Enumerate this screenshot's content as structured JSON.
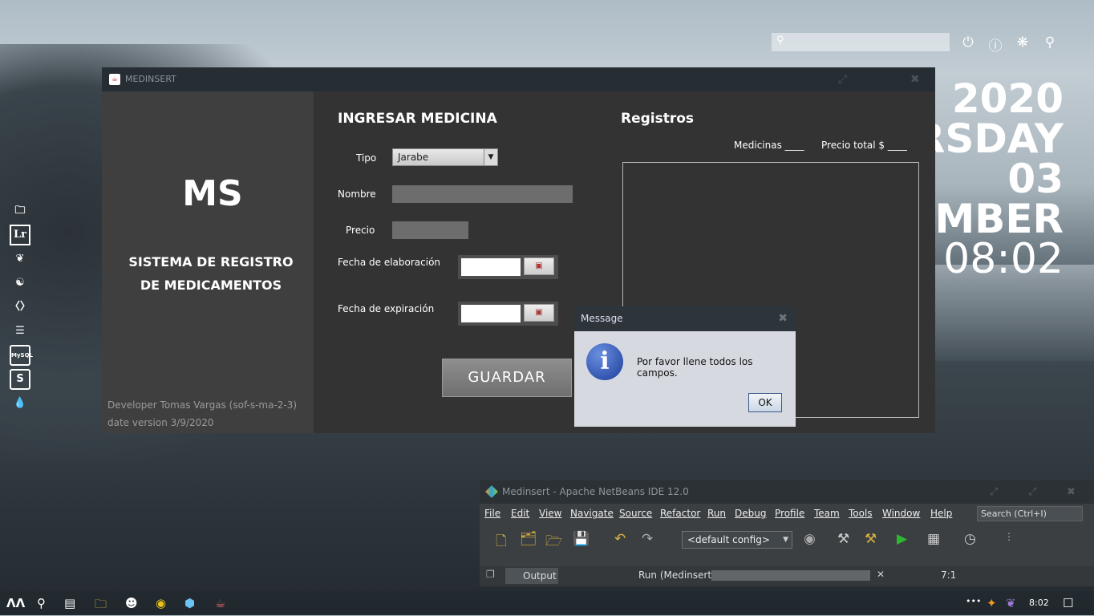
{
  "desktop": {
    "clock": {
      "year": "2020",
      "weekday": "RSDAY",
      "day": "03",
      "month": "MBER",
      "time": "08:02"
    }
  },
  "app": {
    "title": "MEDINSERT",
    "logo": "MS",
    "subtitle_line1": "SISTEMA DE REGISTRO",
    "subtitle_line2": "DE MEDICAMENTOS",
    "developer": "Developer Tomas Vargas (sof-s-ma-2-3)",
    "version_date": "date version 3/9/2020",
    "form": {
      "heading": "INGRESAR MEDICINA",
      "tipo_label": "Tipo",
      "tipo_value": "Jarabe",
      "nombre_label": "Nombre",
      "precio_label": "Precio",
      "fecha_elab_label": "Fecha de elaboración",
      "fecha_exp_label": "Fecha de expiración",
      "save_label": "GUARDAR"
    },
    "registros": {
      "heading": "Registros",
      "medicinas_label": "Medicinas ____",
      "precio_total_label": "Precio total $ ____"
    }
  },
  "dialog": {
    "title": "Message",
    "message": "Por favor llene todos los campos.",
    "ok_label": "OK"
  },
  "netbeans": {
    "title": "Medinsert - Apache NetBeans IDE 12.0",
    "menu": [
      "File",
      "Edit",
      "View",
      "Navigate",
      "Source",
      "Refactor",
      "Run",
      "Debug",
      "Profile",
      "Team",
      "Tools",
      "Window",
      "Help"
    ],
    "search_placeholder": "Search (Ctrl+I)",
    "config": "<default config>",
    "output_tab": "Output",
    "run_status": "Run (Medinsert)",
    "cursor_pos": "7:1"
  },
  "taskbar": {
    "time": "8:02"
  }
}
